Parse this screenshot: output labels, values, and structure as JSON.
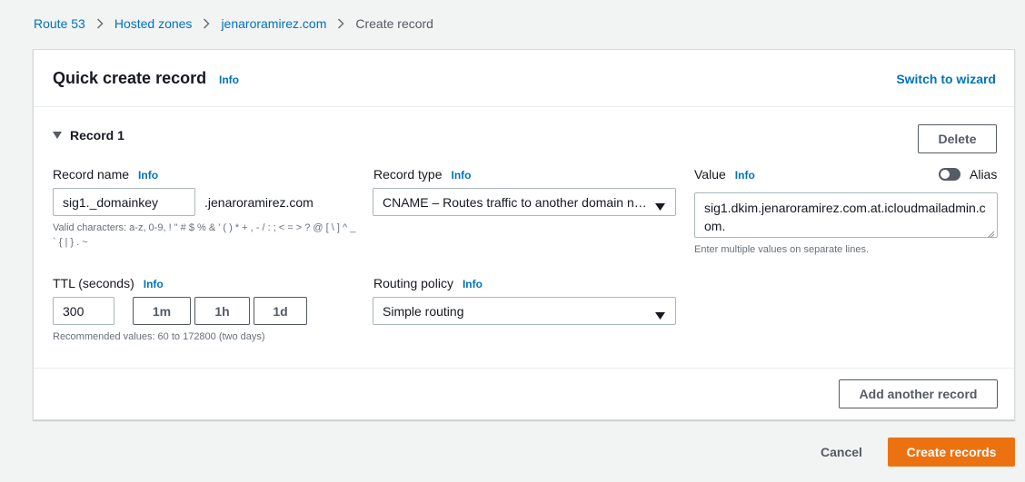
{
  "breadcrumb": {
    "items": [
      "Route 53",
      "Hosted zones",
      "jenaroramirez.com"
    ],
    "current": "Create record"
  },
  "panel": {
    "title": "Quick create record",
    "info": "Info",
    "switch_to_wizard": "Switch to wizard"
  },
  "record": {
    "heading": "Record 1",
    "delete_label": "Delete",
    "record_name": {
      "label": "Record name",
      "info": "Info",
      "value": "sig1._domainkey",
      "suffix": ".jenaroramirez.com",
      "hint": "Valid characters: a-z, 0-9, ! \" # $ % & ' ( ) * + , - / : ; < = > ? @ [ \\ ] ^ _ ` { | } . ~"
    },
    "record_type": {
      "label": "Record type",
      "info": "Info",
      "value": "CNAME – Routes traffic to another domain n…"
    },
    "value": {
      "label": "Value",
      "info": "Info",
      "alias_label": "Alias",
      "alias_on": false,
      "text": "sig1.dkim.jenaroramirez.com.at.icloudmailadmin.com.",
      "hint": "Enter multiple values on separate lines."
    },
    "ttl": {
      "label": "TTL (seconds)",
      "info": "Info",
      "value": "300",
      "presets": [
        "1m",
        "1h",
        "1d"
      ],
      "hint": "Recommended values: 60 to 172800 (two days)"
    },
    "routing_policy": {
      "label": "Routing policy",
      "info": "Info",
      "value": "Simple routing"
    },
    "add_another_label": "Add another record"
  },
  "actions": {
    "cancel": "Cancel",
    "create": "Create records"
  },
  "colors": {
    "link": "#0073bb",
    "primary": "#ec7211",
    "background": "#f2f3f3"
  }
}
